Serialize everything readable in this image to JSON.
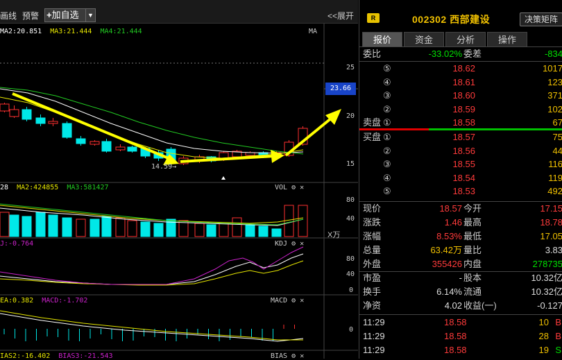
{
  "toolbar": {
    "item1": "画线",
    "item2": "预警",
    "add_label": "加自选",
    "expand_label": "<<展开"
  },
  "main_legend": {
    "ma2": "MA2:20.851",
    "ma3": "MA3:21.444",
    "ma4": "MA4:21.444",
    "tag": "MA"
  },
  "price_axis": {
    "t25": "25",
    "t20": "20",
    "t15": "15",
    "current": "23.66",
    "low_label": "14.59"
  },
  "vol_legend": {
    "a": "28",
    "ma2": "MA2:424855",
    "ma3": "MA3:581427",
    "tag": "VOL",
    "t80": "80",
    "t40": "40",
    "unit": "X万"
  },
  "kdj_legend": {
    "j": "J:-0.764",
    "tag": "KDJ",
    "t80": "80",
    "t40": "40",
    "t0": "0"
  },
  "macd_legend": {
    "a": "EA:0.382",
    "b": "MACD:-1.702",
    "tag": "MACD",
    "t0": "0"
  },
  "bias_legend": {
    "a": "IAS2:-16.402",
    "b": "BIAS3:-21.543",
    "tag": "BIAS"
  },
  "stock": {
    "badge": "R",
    "code": "002302",
    "name": "西部建设",
    "button": "决策矩阵"
  },
  "tabs": [
    "报价",
    "资金",
    "分析",
    "操作"
  ],
  "weibi": {
    "l1": "委比",
    "v1": "-33.02%",
    "l2": "委差",
    "v2": "-834"
  },
  "sell": [
    {
      "n": "⑤",
      "p": "18.62",
      "v": "1017"
    },
    {
      "n": "④",
      "p": "18.61",
      "v": "123"
    },
    {
      "n": "③",
      "p": "18.60",
      "v": "371"
    },
    {
      "n": "②",
      "p": "18.59",
      "v": "102"
    },
    {
      "n": "①",
      "p": "18.58",
      "v": "67"
    }
  ],
  "sell_label": "卖盘",
  "buy_label": "买盘",
  "buy": [
    {
      "n": "①",
      "p": "18.57",
      "v": "75"
    },
    {
      "n": "②",
      "p": "18.56",
      "v": "44"
    },
    {
      "n": "③",
      "p": "18.55",
      "v": "116"
    },
    {
      "n": "④",
      "p": "18.54",
      "v": "119"
    },
    {
      "n": "⑤",
      "p": "18.53",
      "v": "492"
    }
  ],
  "quote": [
    {
      "l1": "现价",
      "v1": "18.57",
      "l2": "今开",
      "v2": "17.15"
    },
    {
      "l1": "涨跌",
      "v1": "1.46",
      "l2": "最高",
      "v2": "18.78"
    },
    {
      "l1": "涨幅",
      "v1": "8.53%",
      "l2": "最低",
      "v2": "17.05"
    },
    {
      "l1": "总量",
      "v1": "63.42万",
      "l2": "量比",
      "v2": "3.83"
    },
    {
      "l1": "外盘",
      "v1": "355426",
      "l2": "内盘",
      "v2": "278735"
    }
  ],
  "fund": [
    {
      "l1": "市盈",
      "v1": "-",
      "l2": "股本",
      "v2": "10.32亿"
    },
    {
      "l1": "换手",
      "v1": "6.14%",
      "l2": "流通",
      "v2": "10.32亿"
    },
    {
      "l1": "净资",
      "v1": "4.02",
      "l2": "收益(一)",
      "v2": "-0.127"
    }
  ],
  "ticks": [
    {
      "t": "11:29",
      "p": "18.58",
      "v": "10",
      "d": "B"
    },
    {
      "t": "11:29",
      "p": "18.58",
      "v": "28",
      "d": "B"
    },
    {
      "t": "11:29",
      "p": "18.58",
      "v": "19",
      "d": "S"
    }
  ]
}
